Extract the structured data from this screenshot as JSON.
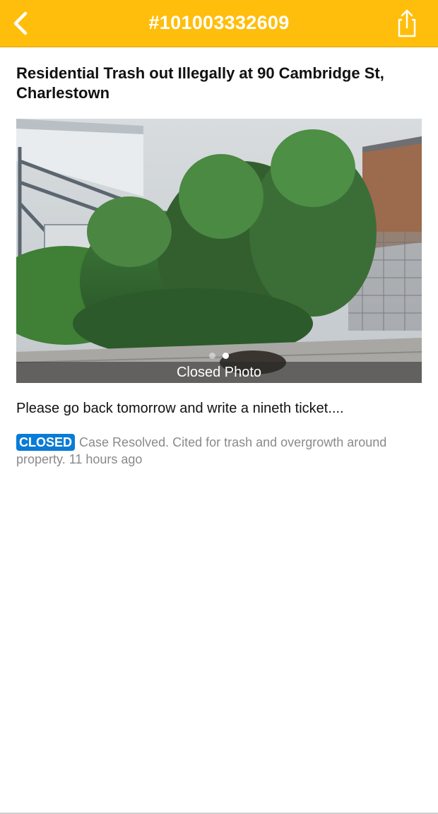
{
  "header": {
    "title": "#101003332609",
    "back_icon": "chevron-left-icon",
    "share_icon": "share-icon",
    "background_color": "#FFBE0B"
  },
  "case": {
    "title": "Residential Trash out Illegally at 90 Cambridge St, Charlestown",
    "photo": {
      "caption": "Closed Photo",
      "page_count": 2,
      "active_index": 1
    },
    "description": "Please go back tomorrow and write a nineth ticket....",
    "status": {
      "badge": "CLOSED",
      "badge_color": "#0A7BD6",
      "text": "Case Resolved. Cited for trash and overgrowth around property. 11 hours ago"
    }
  }
}
